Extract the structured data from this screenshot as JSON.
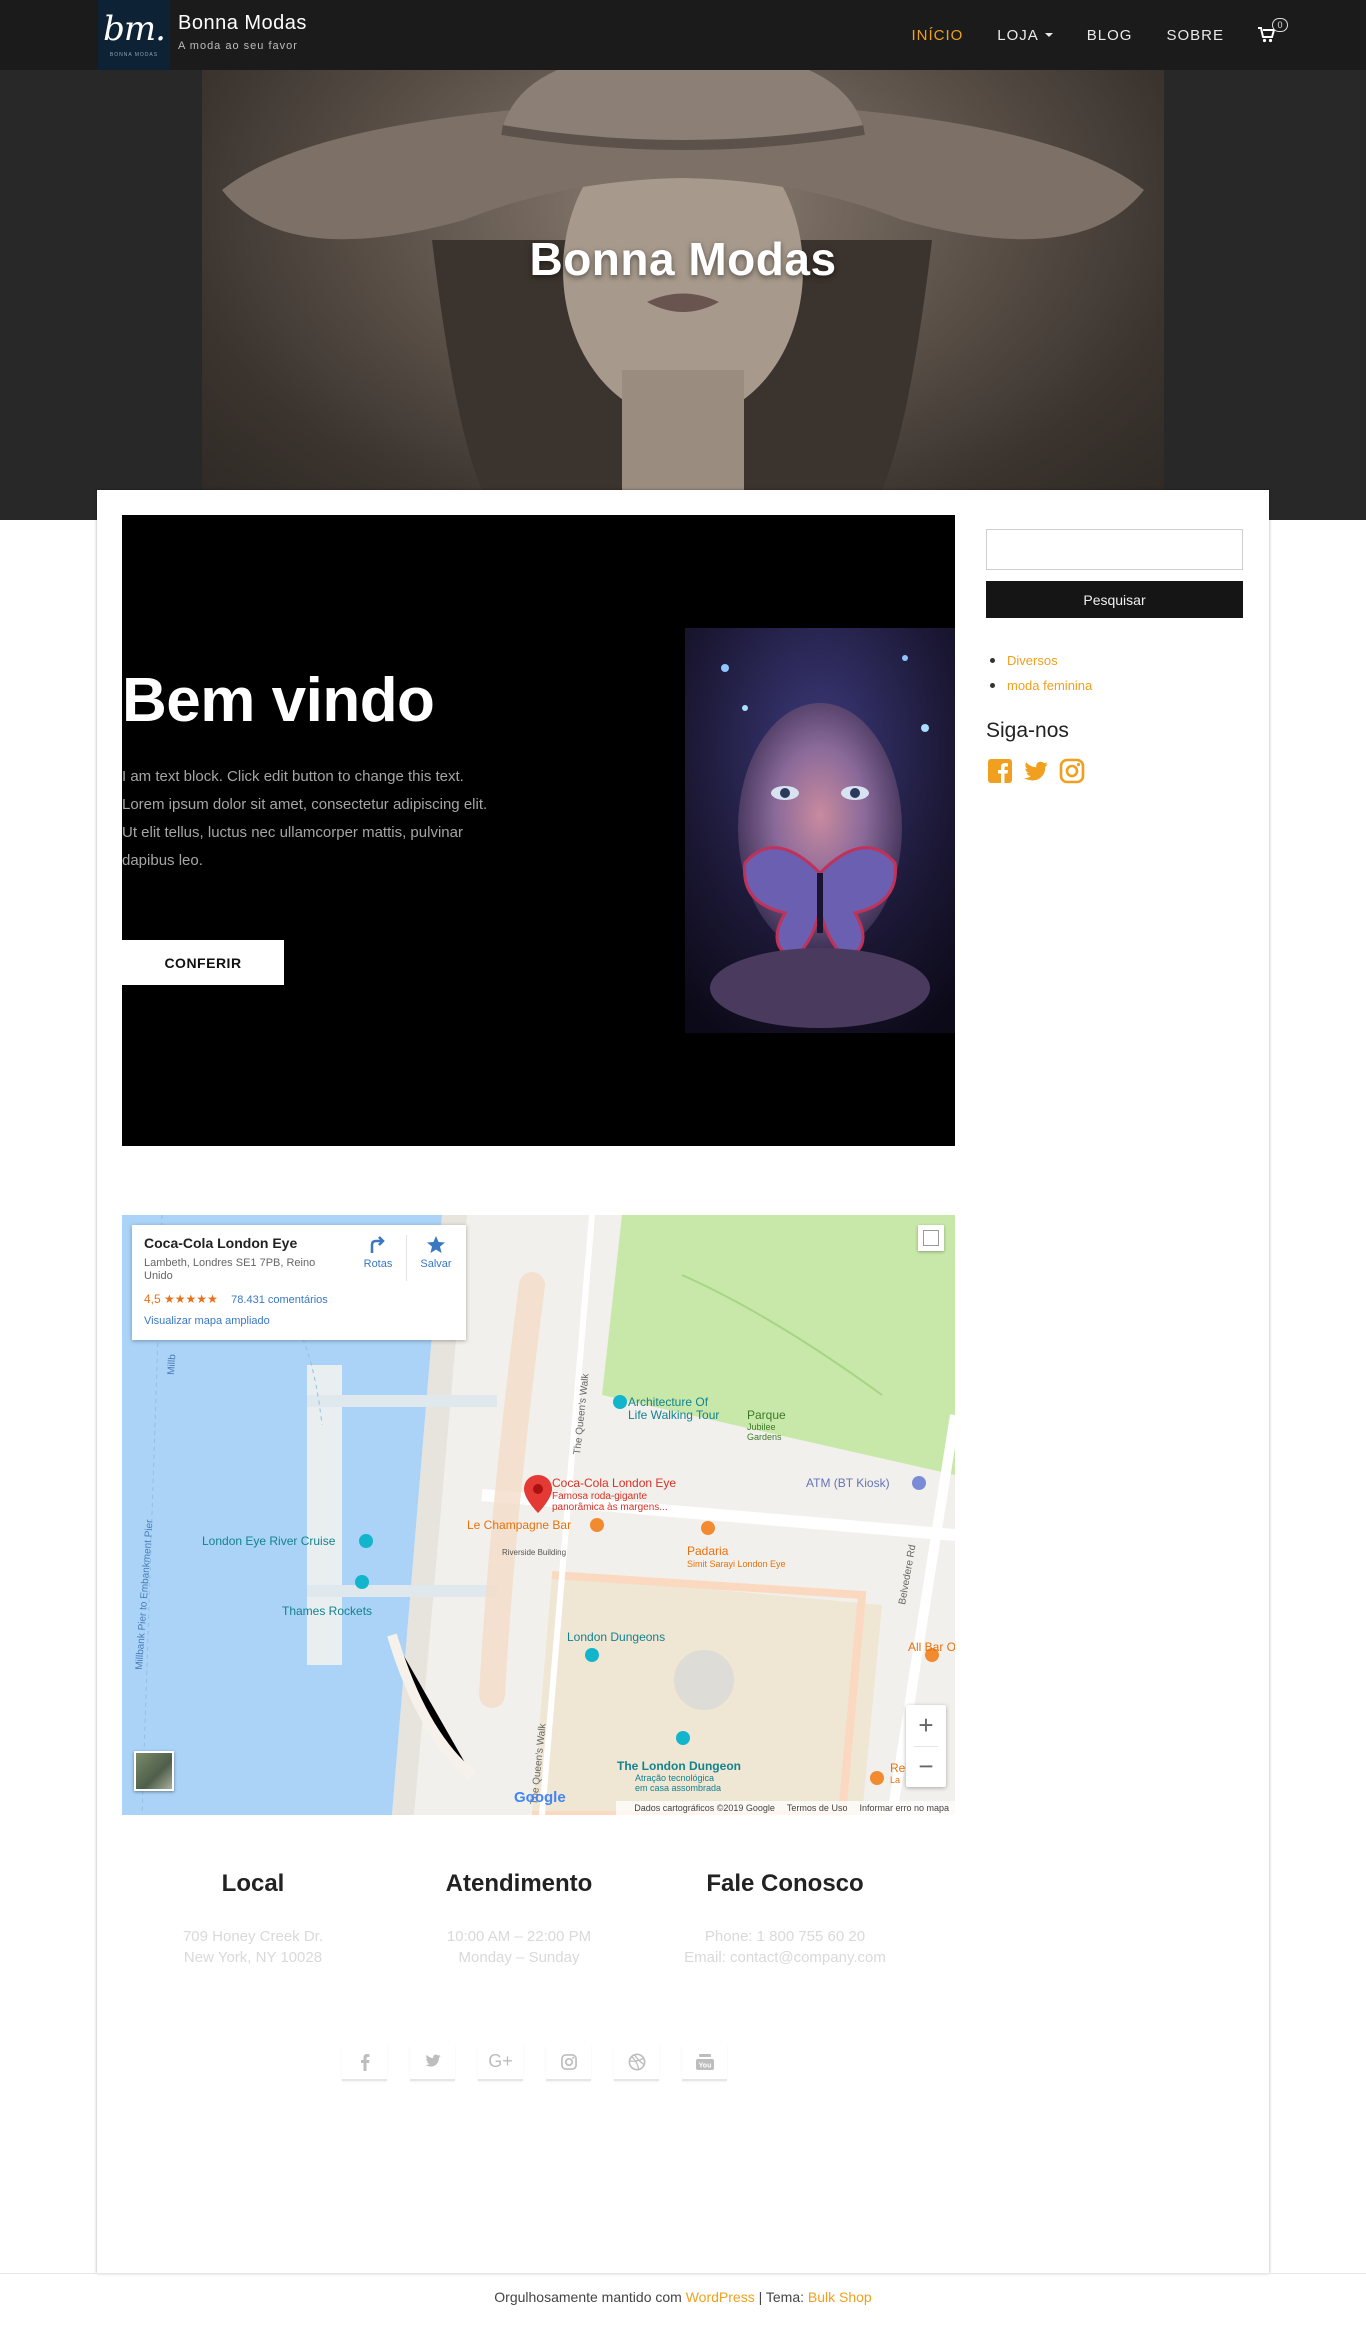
{
  "brand": {
    "logo_text": "bm.",
    "logo_small": "BONNA MODAS",
    "name": "Bonna Modas",
    "tagline": "A moda ao seu favor"
  },
  "nav": {
    "items": [
      "INÍCIO",
      "LOJA",
      "BLOG",
      "SOBRE"
    ],
    "active": "INÍCIO",
    "cart_count": "0"
  },
  "hero": {
    "title": "Bonna Modas"
  },
  "welcome": {
    "title": "Bem vindo",
    "text": "I am text block. Click edit button to change this text. Lorem ipsum dolor sit amet, consectetur adipiscing elit. Ut elit tellus, luctus nec ullamcorper mattis, pulvinar dapibus leo.",
    "button": "CONFERIR"
  },
  "map": {
    "place_title": "Coca-Cola London Eye",
    "address": "Lambeth, Londres SE1 7PB, Reino Unido",
    "rating": "4,5",
    "stars": "★★★★★",
    "reviews": "78.431 comentários",
    "enlarge_link": "Visualizar mapa ampliado",
    "directions": "Rotas",
    "save": "Salvar",
    "labels": {
      "main_pin": "Coca-Cola London Eye",
      "main_pin_sub1": "Famosa roda-gigante",
      "main_pin_sub2": "panorâmica às margens...",
      "architecture": "Architecture Of",
      "architecture2": "Life Walking Tour",
      "parque": "Parque",
      "jubilee": "Jubilee",
      "gardens": "Gardens",
      "atm": "ATM (BT Kiosk)",
      "champagne": "Le Champagne Bar",
      "riverside": "Riverside Building",
      "padaria": "Padaria",
      "simit": "Simit Sarayi London Eye",
      "river_cruise": "London Eye River Cruise",
      "thames": "Thames Rockets",
      "dungeons": "London Dungeons",
      "dungeon2": "The London Dungeon",
      "dungeon_sub1": "Atração tecnológica",
      "dungeon_sub2": "em casa assombrada",
      "all_bar": "All Bar O",
      "re": "Re",
      "la": "La",
      "queens_walk": "The Queen's Walk",
      "belvedere": "Belvedere Rd",
      "millbank": "Millbank Pier to Embankment Pier",
      "millb": "Millb",
      "google": "Google"
    },
    "zoom_in": "+",
    "zoom_out": "−",
    "footer": [
      "Dados cartográficos ©2019 Google",
      "Termos de Uso",
      "Informar erro no mapa"
    ]
  },
  "sidebar": {
    "search_button": "Pesquisar",
    "categories": [
      "Diversos",
      "moda feminina"
    ],
    "follow_title": "Siga-nos"
  },
  "info": [
    {
      "title": "Local",
      "lines": [
        "709 Honey Creek Dr.",
        "New York, NY 10028"
      ]
    },
    {
      "title": "Atendimento",
      "lines": [
        "10:00 AM – 22:00 PM",
        "Monday – Sunday"
      ]
    },
    {
      "title": "Fale Conosco",
      "lines": [
        "Phone: 1 800 755 60 20",
        "Email: contact@company.com"
      ]
    }
  ],
  "social_bottom": [
    "f",
    "twitter",
    "G+",
    "instagram",
    "dribbble",
    "You"
  ],
  "footer": {
    "prefix": "Orgulhosamente mantido com ",
    "wordpress": "WordPress",
    "sep": " | Tema: ",
    "theme": "Bulk Shop"
  },
  "colors": {
    "accent": "#f0a01e",
    "topbar": "#1b1b1b",
    "map_water": "#aad3f7",
    "map_park": "#c8e8a9"
  }
}
